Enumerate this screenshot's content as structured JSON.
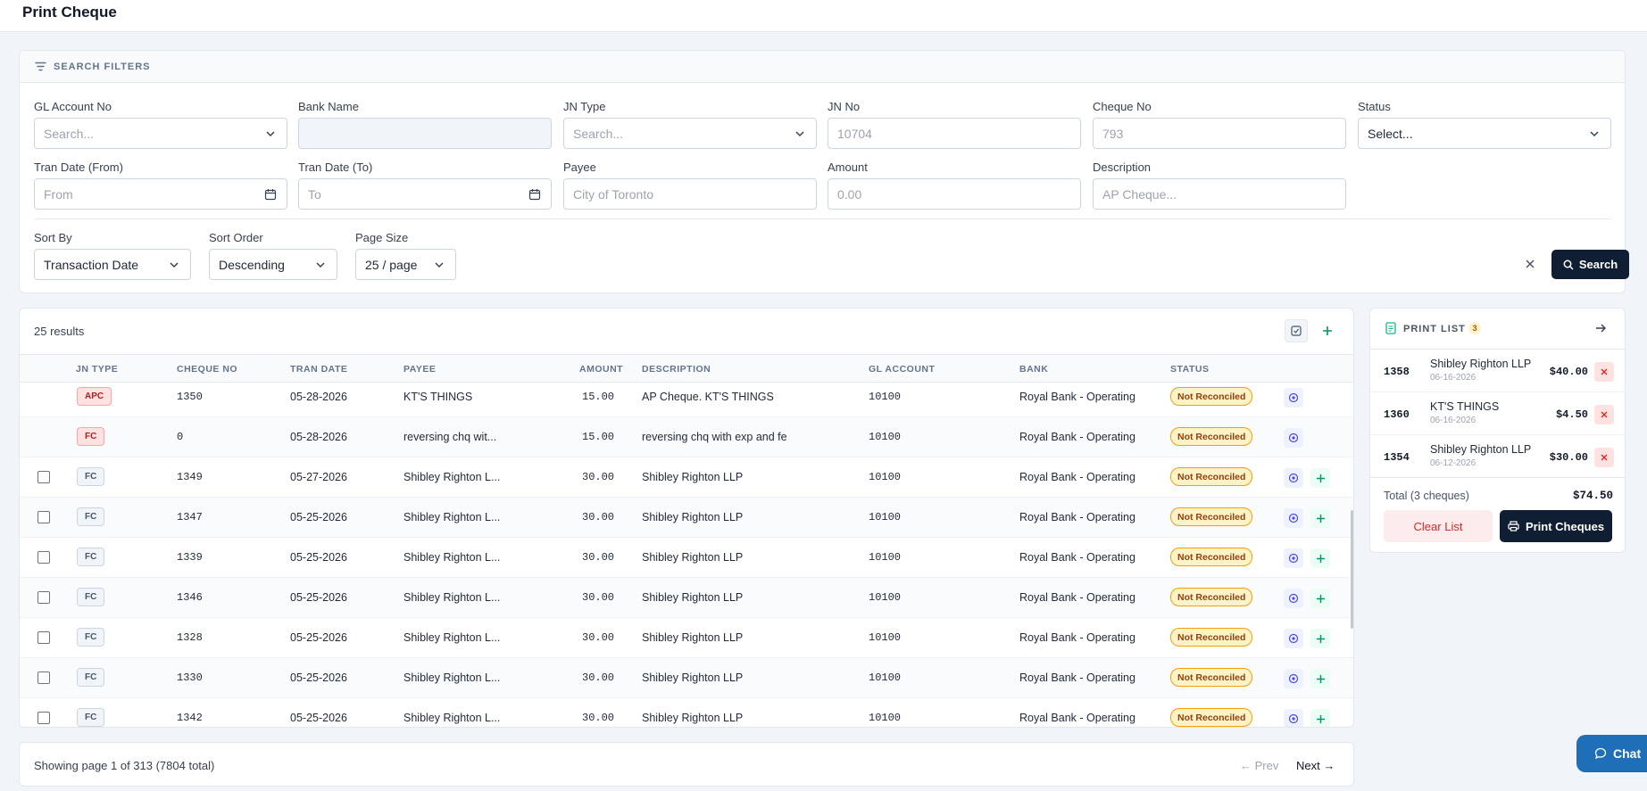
{
  "header": {
    "title": "Print Cheque"
  },
  "filters": {
    "heading": "SEARCH FILTERS",
    "gl_account": {
      "label": "GL Account No",
      "placeholder": "Search..."
    },
    "bank_name": {
      "label": "Bank Name",
      "placeholder": ""
    },
    "jn_type": {
      "label": "JN Type",
      "placeholder": "Search..."
    },
    "jn_no": {
      "label": "JN No",
      "placeholder": "10704"
    },
    "cheque_no": {
      "label": "Cheque No",
      "placeholder": "793"
    },
    "status": {
      "label": "Status",
      "value": "Select..."
    },
    "tran_from": {
      "label": "Tran Date (From)",
      "placeholder": "From"
    },
    "tran_to": {
      "label": "Tran Date (To)",
      "placeholder": "To"
    },
    "payee": {
      "label": "Payee",
      "placeholder": "City of Toronto"
    },
    "amount": {
      "label": "Amount",
      "placeholder": "0.00"
    },
    "description": {
      "label": "Description",
      "placeholder": "AP Cheque..."
    },
    "sort_by": {
      "label": "Sort By",
      "value": "Transaction Date"
    },
    "sort_order": {
      "label": "Sort Order",
      "value": "Descending"
    },
    "page_size": {
      "label": "Page Size",
      "value": "25 / page"
    },
    "search_label": "Search"
  },
  "results": {
    "count": "25 results",
    "columns": [
      "JN TYPE",
      "CHEQUE NO",
      "TRAN DATE",
      "PAYEE",
      "AMOUNT",
      "DESCRIPTION",
      "GL ACCOUNT",
      "BANK",
      "STATUS"
    ],
    "rows": [
      {
        "type": "APC",
        "cheque": "1350",
        "date": "05-28-2026",
        "payee": "KT'S THINGS",
        "amount": "15.00",
        "desc": "AP Cheque. KT'S THINGS",
        "gl": "10100",
        "bank": "Royal Bank - Operating",
        "status": "Not Reconciled"
      },
      {
        "type": "FC",
        "cheque": "0",
        "date": "05-28-2026",
        "payee": "reversing chq wit...",
        "amount": "15.00",
        "desc": "reversing chq with exp and fe",
        "gl": "10100",
        "bank": "Royal Bank - Operating",
        "status": "Not Reconciled"
      },
      {
        "type": "FC",
        "cheque": "1349",
        "date": "05-27-2026",
        "payee": "Shibley Righton L...",
        "amount": "30.00",
        "desc": "Shibley Righton LLP",
        "gl": "10100",
        "bank": "Royal Bank - Operating",
        "status": "Not Reconciled"
      },
      {
        "type": "FC",
        "cheque": "1347",
        "date": "05-25-2026",
        "payee": "Shibley Righton L...",
        "amount": "30.00",
        "desc": "Shibley Righton LLP",
        "gl": "10100",
        "bank": "Royal Bank - Operating",
        "status": "Not Reconciled"
      },
      {
        "type": "FC",
        "cheque": "1339",
        "date": "05-25-2026",
        "payee": "Shibley Righton L...",
        "amount": "30.00",
        "desc": "Shibley Righton LLP",
        "gl": "10100",
        "bank": "Royal Bank - Operating",
        "status": "Not Reconciled"
      },
      {
        "type": "FC",
        "cheque": "1346",
        "date": "05-25-2026",
        "payee": "Shibley Righton L...",
        "amount": "30.00",
        "desc": "Shibley Righton LLP",
        "gl": "10100",
        "bank": "Royal Bank - Operating",
        "status": "Not Reconciled"
      },
      {
        "type": "FC",
        "cheque": "1328",
        "date": "05-25-2026",
        "payee": "Shibley Righton L...",
        "amount": "30.00",
        "desc": "Shibley Righton LLP",
        "gl": "10100",
        "bank": "Royal Bank - Operating",
        "status": "Not Reconciled"
      },
      {
        "type": "FC",
        "cheque": "1330",
        "date": "05-25-2026",
        "payee": "Shibley Righton L...",
        "amount": "30.00",
        "desc": "Shibley Righton LLP",
        "gl": "10100",
        "bank": "Royal Bank - Operating",
        "status": "Not Reconciled"
      },
      {
        "type": "FC",
        "cheque": "1342",
        "date": "05-25-2026",
        "payee": "Shibley Righton L...",
        "amount": "30.00",
        "desc": "Shibley Righton LLP",
        "gl": "10100",
        "bank": "Royal Bank - Operating",
        "status": "Not Reconciled"
      }
    ]
  },
  "pagination": {
    "text": "Showing page 1 of 313 (7804 total)",
    "prev": "← Prev",
    "next": "Next →"
  },
  "print_list": {
    "title": "PRINT LIST",
    "count": "3",
    "items": [
      {
        "cheque": "1358",
        "payee": "Shibley Righton LLP",
        "date": "06-16-2026",
        "amount": "$40.00"
      },
      {
        "cheque": "1360",
        "payee": "KT'S THINGS",
        "date": "06-16-2026",
        "amount": "$4.50"
      },
      {
        "cheque": "1354",
        "payee": "Shibley Righton LLP",
        "date": "06-12-2026",
        "amount": "$30.00"
      }
    ],
    "total_label": "Total (3 cheques)",
    "total_value": "$74.50",
    "clear_label": "Clear List",
    "print_label": "Print Cheques"
  },
  "chat": {
    "label": "Chat"
  },
  "colors": {
    "primary": "#0f1e33",
    "accent": "#1e6fb8",
    "warning": "#fef3c7",
    "danger": "#dc2626"
  }
}
